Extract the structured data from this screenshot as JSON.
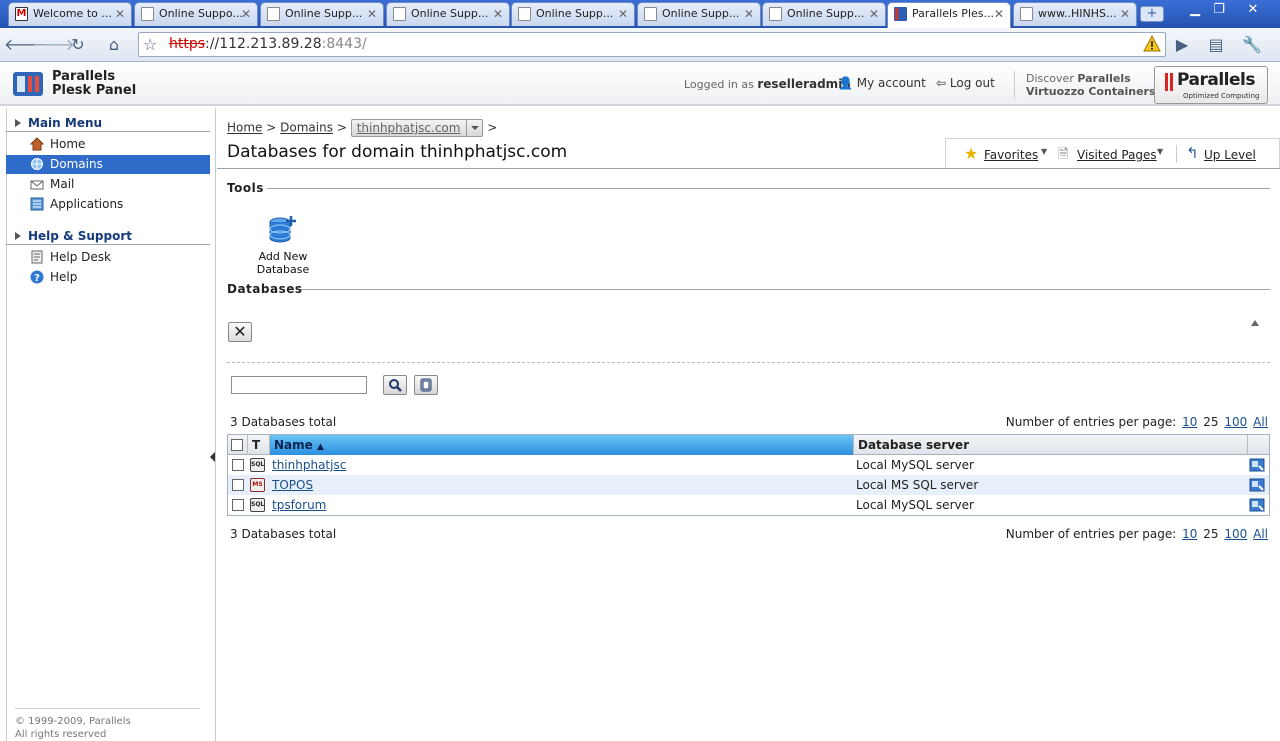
{
  "browser": {
    "tabs": [
      {
        "title": "Welcome to ...",
        "icon": "gmail-icon"
      },
      {
        "title": "Online Suppo...",
        "icon": "page-icon"
      },
      {
        "title": "Online Supp...",
        "icon": "page-icon"
      },
      {
        "title": "Online Supp...",
        "icon": "page-icon"
      },
      {
        "title": "Online Supp...",
        "icon": "page-icon"
      },
      {
        "title": "Online Supp...",
        "icon": "page-icon"
      },
      {
        "title": "Online Supp...",
        "icon": "page-icon"
      },
      {
        "title": "Parallels Ples...",
        "icon": "plesk-icon",
        "active": true
      },
      {
        "title": "www..HINHS...",
        "icon": "page-icon"
      }
    ],
    "url_scheme": "https",
    "url_sep": "://",
    "url_host": "112.213.89.28",
    "url_port": ":8443/"
  },
  "header": {
    "product_line1": "Parallels",
    "product_line2": "Plesk Panel",
    "logged_in_label": "Logged in as",
    "username": "reselleradmin",
    "my_account": "My account",
    "log_out": "Log out",
    "discover_label": "Discover",
    "discover_brand": "Parallels",
    "discover_product": "Virtuozzo Containers",
    "brand_logo": "Parallels",
    "brand_tagline": "Optimized Computing"
  },
  "sidebar": {
    "main_menu_title": "Main Menu",
    "main_items": [
      {
        "label": "Home",
        "icon": "home-icon"
      },
      {
        "label": "Domains",
        "icon": "domains-icon",
        "active": true
      },
      {
        "label": "Mail",
        "icon": "mail-icon"
      },
      {
        "label": "Applications",
        "icon": "applications-icon"
      }
    ],
    "support_title": "Help & Support",
    "support_items": [
      {
        "label": "Help Desk",
        "icon": "helpdesk-icon"
      },
      {
        "label": "Help",
        "icon": "help-icon"
      }
    ],
    "footer_line1": "© 1999-2009, Parallels",
    "footer_line2": "All rights reserved"
  },
  "main": {
    "breadcrumb": {
      "home": "Home",
      "sep": ">",
      "domains": "Domains",
      "domain": "thinhphatjsc.com"
    },
    "title": "Databases for domain thinhphatjsc.com",
    "topbar": {
      "favorites": "Favorites",
      "visited": "Visited Pages",
      "up_level": "Up Level"
    },
    "tools_title": "Tools",
    "add_db_label": "Add New Database",
    "databases_title": "Databases",
    "search_value": "",
    "total_text": "3 Databases total",
    "per_page_label": "Number of entries per page:",
    "per_page_options": [
      "10",
      "25",
      "100",
      "All"
    ],
    "table": {
      "col_type": "T",
      "col_name": "Name",
      "col_server": "Database server",
      "rows": [
        {
          "name": "thinhphatjsc",
          "server": "Local MySQL server",
          "type": "SQL"
        },
        {
          "name": "TOPOS",
          "server": "Local MS SQL server",
          "type": "MS"
        },
        {
          "name": "tpsforum",
          "server": "Local MySQL server",
          "type": "SQL"
        }
      ]
    }
  },
  "colors": {
    "active_nav": "#2f6cc9",
    "sorted_header": "#2c8fe0",
    "link": "#1a4f8c",
    "alt_row": "#e7f0fa"
  }
}
